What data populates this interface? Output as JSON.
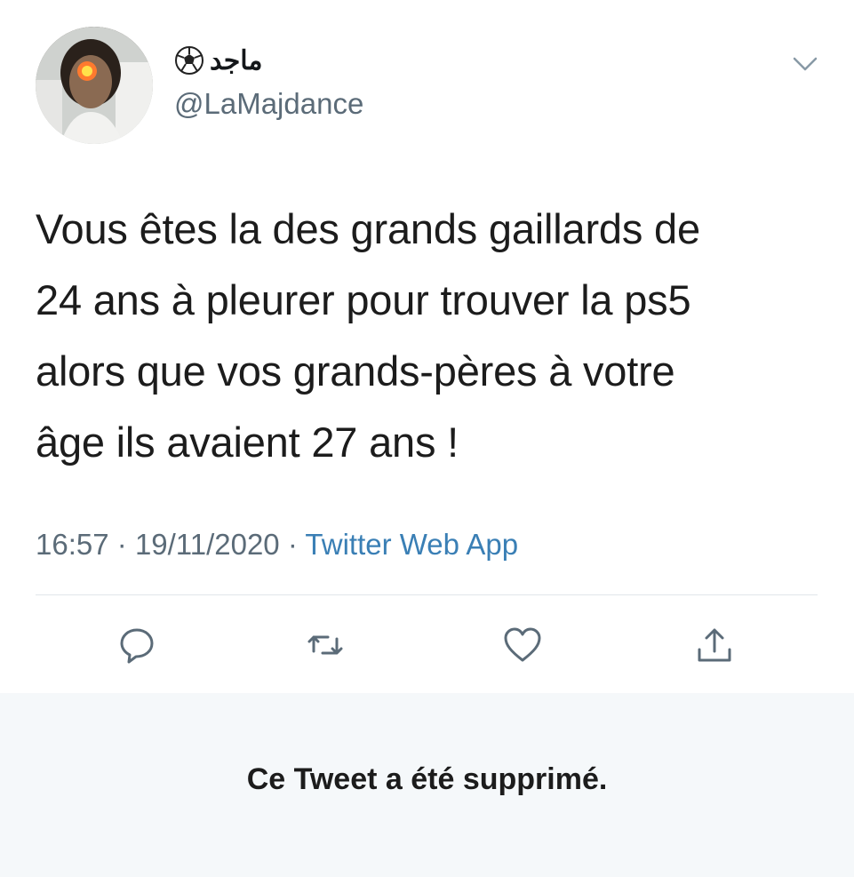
{
  "tweet": {
    "display_name": "ماجد",
    "name_emoji": "soccer-ball-icon",
    "handle": "@LaMajdance",
    "body_lines": [
      "Vous êtes la des grands gaillards de",
      "24 ans à pleurer pour trouver la ps5",
      "alors que vos grands-pères à votre",
      "âge ils avaient 27 ans !"
    ],
    "time": "16:57",
    "separator": "·",
    "date": "19/11/2020",
    "source": "Twitter Web App"
  },
  "actions": {
    "reply": "reply-icon",
    "retweet": "retweet-icon",
    "like": "heart-icon",
    "share": "share-icon"
  },
  "quoted": {
    "deleted_message": "Ce Tweet a été supprimé."
  },
  "colors": {
    "text": "#14171a",
    "secondary": "#5b6b78",
    "link": "#3a7fb5",
    "deleted_bg": "#f5f8fa"
  }
}
